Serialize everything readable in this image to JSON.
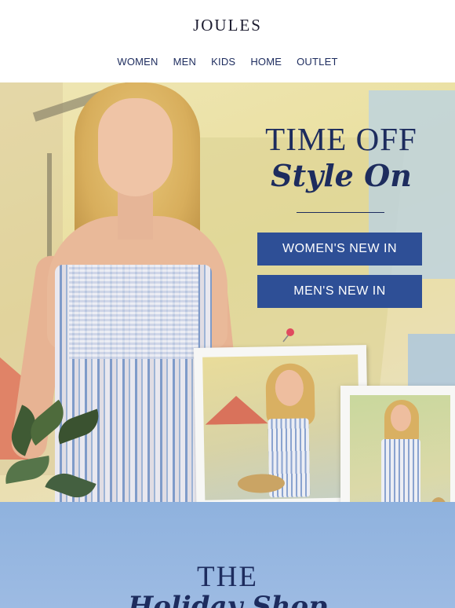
{
  "header": {
    "logo": "JOULES",
    "nav": [
      "WOMEN",
      "MEN",
      "KIDS",
      "HOME",
      "OUTLET"
    ]
  },
  "hero": {
    "headline_line1": "TIME OFF",
    "headline_line2": "Style On",
    "cta_women": "WOMEN'S NEW IN",
    "cta_men": "MEN'S NEW IN"
  },
  "banner": {
    "title_line1": "THE",
    "title_line2": "Holiday Shop"
  },
  "colors": {
    "navy": "#1d2c5e",
    "button_blue": "#2e4f96",
    "banner_blue": "#8fb2de",
    "background_yellow": "#e9df9e"
  }
}
